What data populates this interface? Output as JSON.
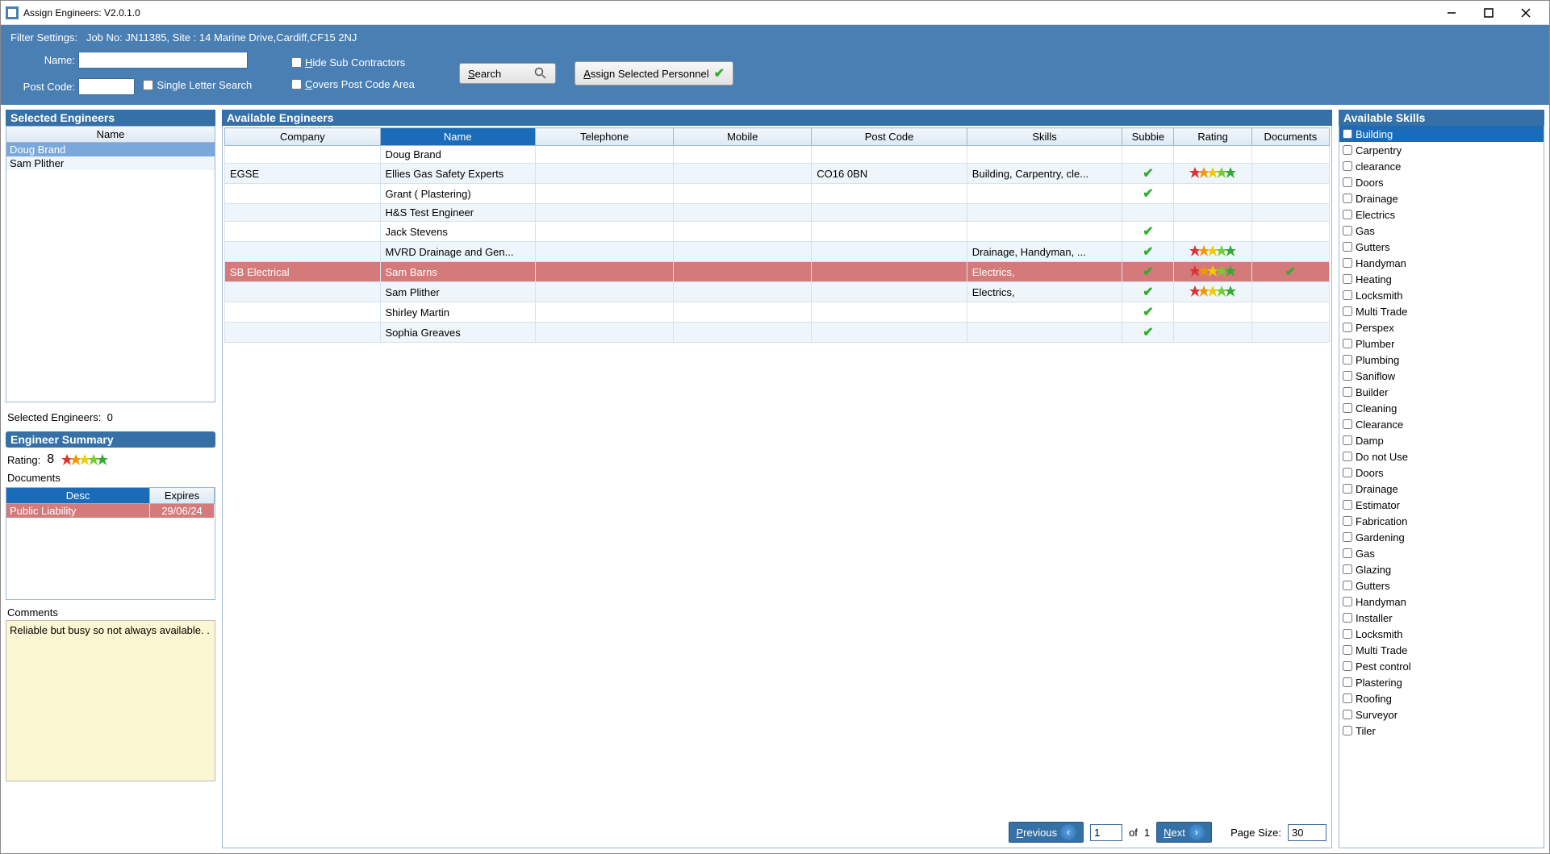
{
  "window": {
    "title": "Assign Engineers: V2.0.1.0"
  },
  "filter": {
    "settings_label": "Filter Settings:",
    "settings_text": "Job No: JN11385, Site : 14 Marine Drive,Cardiff,CF15 2NJ",
    "name_label": "Name:",
    "name_value": "",
    "postcode_label": "Post Code:",
    "postcode_value": "",
    "single_letter": "Single Letter Search",
    "hide_sub": "Hide Sub Contractors",
    "covers_area": "Covers Post Code Area",
    "search_btn": "Search",
    "assign_btn": "Assign Selected Personnel"
  },
  "selected": {
    "title": "Selected Engineers",
    "col_name": "Name",
    "items": [
      {
        "name": "Doug Brand",
        "selected": true
      },
      {
        "name": "Sam Plither",
        "selected": false
      }
    ],
    "count_label": "Selected Engineers:",
    "count": "0"
  },
  "summary": {
    "title": "Engineer Summary",
    "rating_label": "Rating:",
    "rating_value": "8",
    "documents_label": "Documents",
    "doc_cols": {
      "desc": "Desc",
      "expires": "Expires"
    },
    "doc_rows": [
      {
        "desc": "Public Liability",
        "expires": "29/06/24"
      }
    ],
    "comments_label": "Comments",
    "comments_text": "Reliable but busy so not always available. ."
  },
  "available": {
    "title": "Available Engineers",
    "cols": {
      "company": "Company",
      "name": "Name",
      "telephone": "Telephone",
      "mobile": "Mobile",
      "postcode": "Post Code",
      "skills": "Skills",
      "subbie": "Subbie",
      "rating": "Rating",
      "documents": "Documents"
    },
    "rows": [
      {
        "company": "",
        "name": "Doug Brand",
        "telephone": "",
        "mobile": "",
        "postcode": "",
        "skills": "",
        "subbie": false,
        "rating": false,
        "documents": false,
        "hl": false
      },
      {
        "company": "EGSE",
        "name": "Ellies Gas Safety Experts",
        "telephone": "",
        "mobile": "",
        "postcode": "CO16 0BN",
        "skills": "Building,  Carpentry,  cle...",
        "subbie": true,
        "rating": true,
        "documents": false,
        "hl": false
      },
      {
        "company": "",
        "name": "Grant ( Plastering)",
        "telephone": "",
        "mobile": "",
        "postcode": "",
        "skills": "",
        "subbie": true,
        "rating": false,
        "documents": false,
        "hl": false
      },
      {
        "company": "",
        "name": "H&S Test Engineer",
        "telephone": "",
        "mobile": "",
        "postcode": "",
        "skills": "",
        "subbie": false,
        "rating": false,
        "documents": false,
        "hl": false
      },
      {
        "company": "",
        "name": "Jack Stevens",
        "telephone": "",
        "mobile": "",
        "postcode": "",
        "skills": "",
        "subbie": true,
        "rating": false,
        "documents": false,
        "hl": false
      },
      {
        "company": "",
        "name": "MVRD Drainage and Gen...",
        "telephone": "",
        "mobile": "",
        "postcode": "",
        "skills": "Drainage,  Handyman,  ...",
        "subbie": true,
        "rating": true,
        "documents": false,
        "hl": false
      },
      {
        "company": "SB Electrical",
        "name": "Sam Barns",
        "telephone": "",
        "mobile": "",
        "postcode": "",
        "skills": "Electrics,",
        "subbie": true,
        "rating": true,
        "documents": true,
        "hl": true
      },
      {
        "company": "",
        "name": "Sam Plither",
        "telephone": "",
        "mobile": "",
        "postcode": "",
        "skills": "Electrics,",
        "subbie": true,
        "rating": true,
        "documents": false,
        "hl": false
      },
      {
        "company": "",
        "name": "Shirley Martin",
        "telephone": "",
        "mobile": "",
        "postcode": "",
        "skills": "",
        "subbie": true,
        "rating": false,
        "documents": false,
        "hl": false
      },
      {
        "company": "",
        "name": "Sophia Greaves",
        "telephone": "",
        "mobile": "",
        "postcode": "",
        "skills": "",
        "subbie": true,
        "rating": false,
        "documents": false,
        "hl": false
      }
    ]
  },
  "pager": {
    "prev": "Previous",
    "next": "Next",
    "page_value": "1",
    "of_label": "of",
    "total_pages": "1",
    "pagesize_label": "Page Size:",
    "pagesize_value": "30"
  },
  "skills": {
    "title": "Available Skills",
    "items": [
      {
        "label": "Building",
        "selected": true
      },
      {
        "label": "Carpentry"
      },
      {
        "label": "clearance"
      },
      {
        "label": "Doors"
      },
      {
        "label": "Drainage"
      },
      {
        "label": "Electrics"
      },
      {
        "label": "Gas"
      },
      {
        "label": "Gutters"
      },
      {
        "label": "Handyman"
      },
      {
        "label": "Heating"
      },
      {
        "label": "Locksmith"
      },
      {
        "label": "Multi Trade"
      },
      {
        "label": "Perspex"
      },
      {
        "label": "Plumber"
      },
      {
        "label": "Plumbing"
      },
      {
        "label": "Saniflow"
      },
      {
        "label": "Builder"
      },
      {
        "label": "Cleaning"
      },
      {
        "label": "Clearance"
      },
      {
        "label": "Damp"
      },
      {
        "label": "Do not Use"
      },
      {
        "label": "Doors"
      },
      {
        "label": "Drainage"
      },
      {
        "label": "Estimator"
      },
      {
        "label": "Fabrication"
      },
      {
        "label": "Gardening"
      },
      {
        "label": "Gas"
      },
      {
        "label": "Glazing"
      },
      {
        "label": "Gutters"
      },
      {
        "label": "Handyman"
      },
      {
        "label": "Installer"
      },
      {
        "label": "Locksmith"
      },
      {
        "label": "Multi Trade"
      },
      {
        "label": "Pest control"
      },
      {
        "label": "Plastering"
      },
      {
        "label": "Roofing"
      },
      {
        "label": "Surveyor"
      },
      {
        "label": "Tiler"
      }
    ]
  }
}
